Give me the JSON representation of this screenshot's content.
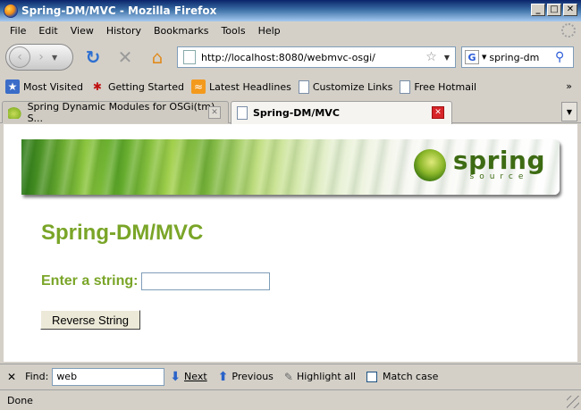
{
  "window": {
    "title": "Spring-DM/MVC - Mozilla Firefox",
    "controls": [
      "_",
      "□",
      "✕"
    ]
  },
  "menu": {
    "items": [
      {
        "label": "File"
      },
      {
        "label": "Edit"
      },
      {
        "label": "View"
      },
      {
        "label": "History"
      },
      {
        "label": "Bookmarks"
      },
      {
        "label": "Tools"
      },
      {
        "label": "Help"
      }
    ]
  },
  "nav": {
    "back_glyph": "‹",
    "forward_glyph": "›",
    "dropdown_glyph": "▼",
    "reload_glyph": "↻",
    "stop_glyph": "✕",
    "home_glyph": "⌂",
    "url": "http://localhost:8080/webmvc-osgi/",
    "star_glyph": "☆",
    "search_engine_glyph": "G",
    "search_value": "spring-dm",
    "search_glyph": "⚲"
  },
  "bookmarks": {
    "items": [
      {
        "label": "Most Visited",
        "icon": "most-visited-icon",
        "glyph": "★"
      },
      {
        "label": "Getting Started",
        "icon": "bug-icon",
        "glyph": "✱"
      },
      {
        "label": "Latest Headlines",
        "icon": "rss-icon",
        "glyph": "≈"
      },
      {
        "label": "Customize Links",
        "icon": "page-icon",
        "glyph": ""
      },
      {
        "label": "Free Hotmail",
        "icon": "page-icon",
        "glyph": ""
      }
    ],
    "overflow_glyph": "»"
  },
  "tabs": [
    {
      "label": "Spring Dynamic Modules for OSGi(tm) S...",
      "active": false,
      "close_glyph": "✕"
    },
    {
      "label": "Spring-DM/MVC",
      "active": true,
      "close_glyph": "✕"
    }
  ],
  "tab_menu_glyph": "▼",
  "page": {
    "banner_logo_main": "spring",
    "banner_logo_sub": "source",
    "heading": "Spring-DM/MVC",
    "form_label": "Enter a string:",
    "input_value": "",
    "button_label": "Reverse String"
  },
  "findbar": {
    "close_glyph": "✕",
    "label": "Find:",
    "value": "web",
    "next_label": "Next",
    "previous_label": "Previous",
    "highlight_label": "Highlight all",
    "match_case_label": "Match case",
    "next_glyph": "⬇",
    "previous_glyph": "⬆",
    "highlight_glyph": "✎"
  },
  "status": {
    "text": "Done"
  },
  "colors": {
    "accent_green": "#7aa528",
    "tab_close_red": "#d7262a",
    "titlebar_blue": "#0a246a"
  }
}
